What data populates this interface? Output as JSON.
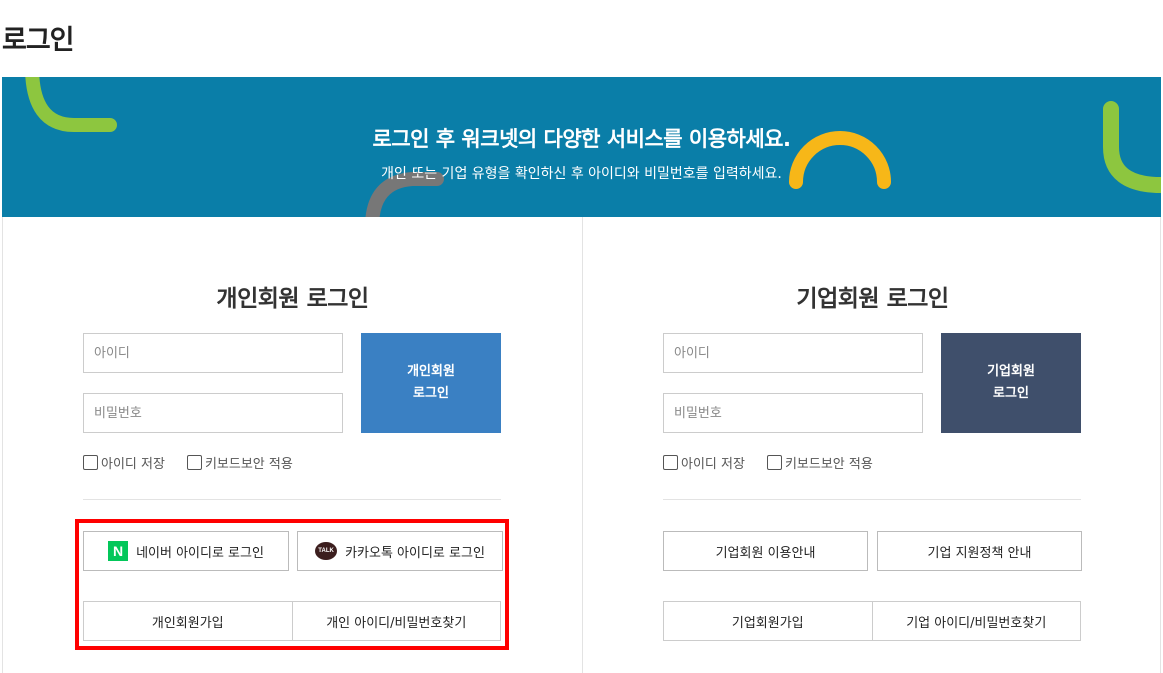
{
  "page": {
    "title": "로그인"
  },
  "banner": {
    "heading": "로그인 후 워크넷의 다양한 서비스를 이용하세요.",
    "subheading": "개인 또는 기업 유형을 확인하신 후 아이디와 비밀번호를 입력하세요.",
    "colors": {
      "background": "#0a7ea8",
      "green": "#8dc63f",
      "yellow": "#f7b718",
      "gray": "#777777"
    }
  },
  "personal": {
    "title": "개인회원 로그인",
    "id_placeholder": "아이디",
    "pw_placeholder": "비밀번호",
    "login_button": {
      "line1": "개인회원",
      "line2": "로그인"
    },
    "save_id_label": "아이디 저장",
    "keyboard_security_label": "키보드보안 적용",
    "naver_login": "네이버 아이디로 로그인",
    "naver_icon": "N",
    "kakao_login": "카카오톡 아이디로 로그인",
    "kakao_icon": "TALK",
    "signup": "개인회원가입",
    "find_account": "개인 아이디/비밀번호찾기",
    "accent": "#3a80c3"
  },
  "corporate": {
    "title": "기업회원 로그인",
    "id_placeholder": "아이디",
    "pw_placeholder": "비밀번호",
    "login_button": {
      "line1": "기업회원",
      "line2": "로그인"
    },
    "save_id_label": "아이디 저장",
    "keyboard_security_label": "키보드보안 적용",
    "guide": "기업회원 이용안내",
    "support_policy": "기업 지원정책 안내",
    "signup": "기업회원가입",
    "find_account": "기업 아이디/비밀번호찾기",
    "accent": "#3f4f6b"
  }
}
